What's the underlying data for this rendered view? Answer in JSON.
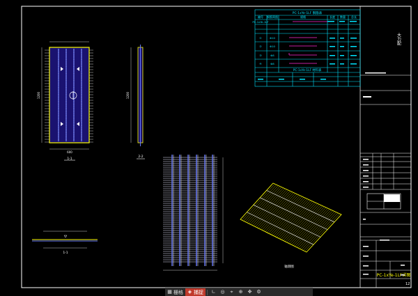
{
  "drawing": {
    "table1": {
      "title": "PC-1xYe-1LF 钢筋表",
      "header": [
        "编号",
        "钢筋简图",
        "规格",
        "长度",
        "数量",
        "总长"
      ],
      "rows": [
        [
          "PC-1xYe-1LF",
          "",
          "",
          "",
          "",
          ""
        ],
        [
          "",
          "",
          "",
          "",
          "",
          ""
        ],
        [
          "①",
          "",
          "Φ10",
          "",
          "",
          ""
        ],
        [
          "②",
          "",
          "Φ10",
          "",
          "",
          ""
        ],
        [
          "③",
          "",
          "Φ8",
          "",
          "",
          ""
        ],
        [
          "④",
          "",
          "Φ8",
          "",
          "",
          ""
        ]
      ]
    },
    "table2": {
      "title": "PC-1xYe-1LF 材料表"
    },
    "title_block": {
      "project": "大力配",
      "sheet_name": "PC-1xYe-1LF详图",
      "page_num": "12"
    },
    "view_labels": {
      "plan": "1-1",
      "section": "2-2",
      "detail": "1-1",
      "axon": "轴测图"
    },
    "dims": {
      "plan_w": "600",
      "plan_h": "1200",
      "section_h": "1200"
    }
  },
  "toolbar": {
    "items": [
      {
        "icon": "grid-icon",
        "label": "栅格",
        "active": false
      },
      {
        "icon": "snap-icon",
        "label": "捕捉",
        "active": true
      },
      {
        "icon": "ortho-icon",
        "label": "",
        "active": false
      },
      {
        "icon": "polar-icon",
        "label": "",
        "active": false
      },
      {
        "icon": "osnap-icon",
        "label": "",
        "active": false
      },
      {
        "icon": "zoom-icon",
        "label": "",
        "active": false
      },
      {
        "icon": "pan-icon",
        "label": "",
        "active": false
      },
      {
        "icon": "settings-icon",
        "label": "",
        "active": false
      }
    ]
  }
}
